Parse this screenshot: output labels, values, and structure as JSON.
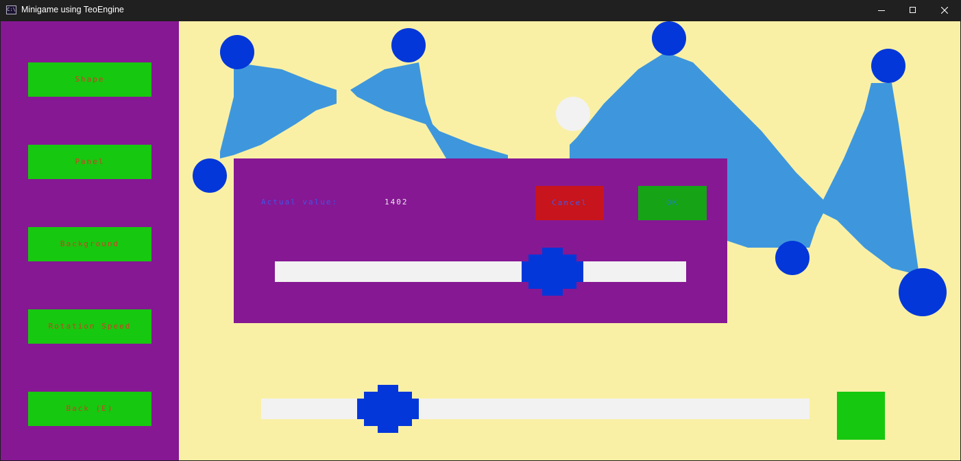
{
  "window": {
    "title": "Minigame using TeoEngine",
    "app_icon_glyph": "C:\\",
    "controls": [
      "minimize-icon",
      "maximize-icon",
      "close-icon"
    ]
  },
  "sidebar": {
    "items": [
      {
        "label": "Shape"
      },
      {
        "label": "Panel"
      },
      {
        "label": "Background"
      },
      {
        "label": "Rotation Speed"
      },
      {
        "label": "Back (E)"
      }
    ]
  },
  "dialog": {
    "actual_value_label": "Actual value:",
    "actual_value": "1402",
    "cancel_label": "Cancel",
    "ok_label": "OK"
  },
  "colors": {
    "sidebar_bg": "#861893",
    "canvas_bg": "#f9f0a6",
    "button_green": "#16c80f",
    "shape_fill": "#3e97dd",
    "vertex_dot": "#0337d9",
    "cancel_red": "#c8141c",
    "ok_green": "#16a316"
  }
}
